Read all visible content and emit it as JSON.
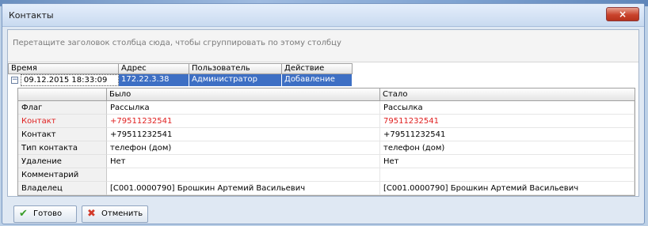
{
  "window": {
    "title": "Контакты",
    "close_glyph": "×"
  },
  "group_panel": {
    "hint": "Перетащите заголовок столбца сюда, чтобы сгруппировать по этому столбцу"
  },
  "grid": {
    "columns": [
      "Время",
      "Адрес",
      "Пользователь",
      "Действие"
    ],
    "row": {
      "expander": "−",
      "time": "09.12.2015 18:33:09",
      "address": "172.22.3.38",
      "user": "Администратор",
      "action": "Добавление"
    }
  },
  "detail": {
    "columns": [
      "",
      "Было",
      "Стало"
    ],
    "rows": [
      {
        "label": "Флаг",
        "before": "Рассылка",
        "after": "Рассылка",
        "changed": false
      },
      {
        "label": "Контакт",
        "before": "+79511232541",
        "after": "79511232541",
        "changed": true
      },
      {
        "label": "Контакт",
        "before": "+79511232541",
        "after": "+79511232541",
        "changed": false
      },
      {
        "label": "Тип контакта",
        "before": "телефон (дом)",
        "after": "телефон (дом)",
        "changed": false
      },
      {
        "label": "Удаление",
        "before": "Нет",
        "after": "Нет",
        "changed": false
      },
      {
        "label": "Комментарий",
        "before": "",
        "after": "",
        "changed": false
      },
      {
        "label": "Владелец",
        "before": "[C001.0000790] Брошкин Артемий Васильевич",
        "after": "[C001.0000790] Брошкин Артемий Васильевич",
        "changed": false
      }
    ]
  },
  "buttons": {
    "ok": "Готово",
    "cancel": "Отменить"
  },
  "icons": {
    "ok": "check-icon",
    "cancel": "cross-icon"
  },
  "colors": {
    "selection": "#3d6fc4",
    "changed_text": "#e02020",
    "ok_icon": "#3a9d2a",
    "cancel_icon": "#d23a2a"
  }
}
